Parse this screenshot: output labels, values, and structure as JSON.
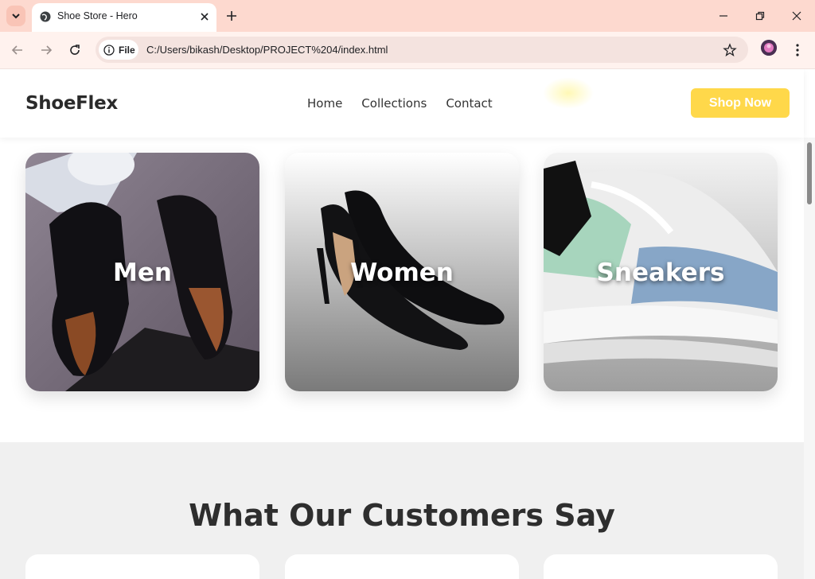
{
  "browser": {
    "tab_title": "Shoe Store - Hero",
    "url_chip_label": "File",
    "url": "C:/Users/bikash/Desktop/PROJECT%204/index.html",
    "icons": [
      "tab-search-icon",
      "globe-icon",
      "close-icon",
      "plus-icon",
      "minimize-icon",
      "restore-icon",
      "close-window-icon",
      "back-icon",
      "forward-icon",
      "reload-icon",
      "info-icon",
      "star-icon",
      "profile-avatar",
      "more-vert-icon"
    ]
  },
  "site": {
    "logo": "ShoeFlex",
    "nav": [
      "Home",
      "Collections",
      "Contact"
    ],
    "cta": "Shop Now",
    "accent_color": "#ffd84a"
  },
  "categories": [
    {
      "label": "Men"
    },
    {
      "label": "Women"
    },
    {
      "label": "Sneakers"
    }
  ],
  "testimonials": {
    "title": "What Our Customers Say"
  }
}
